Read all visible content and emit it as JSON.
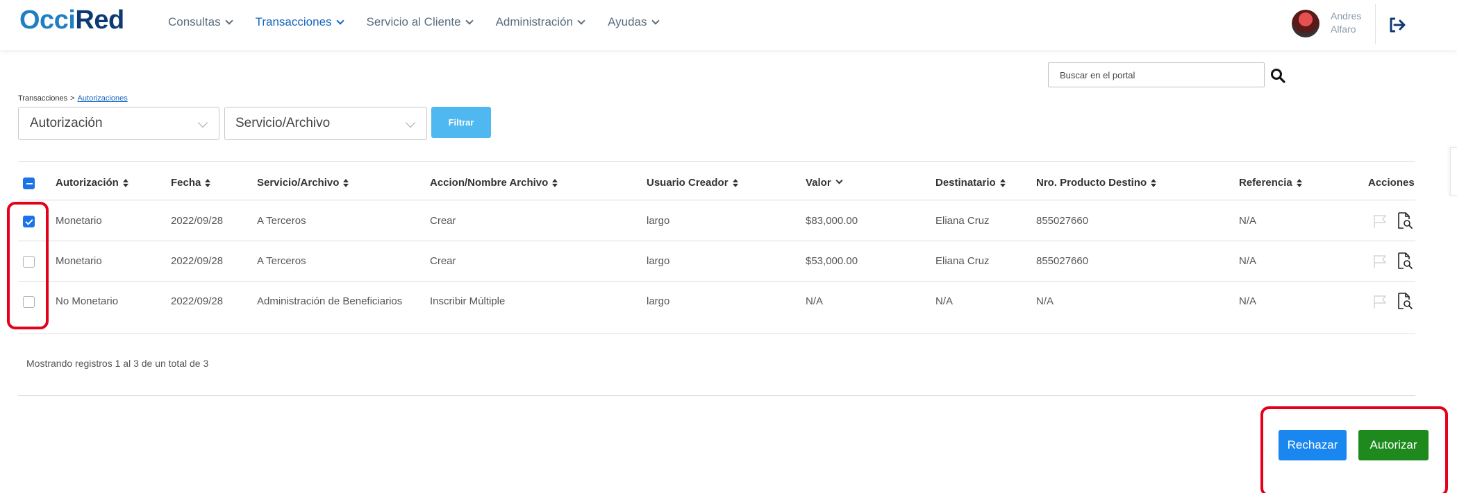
{
  "brand": {
    "part1": "Occi",
    "part2": "Red"
  },
  "nav": [
    {
      "label": "Consultas",
      "active": false
    },
    {
      "label": "Transacciones",
      "active": true
    },
    {
      "label": "Servicio al Cliente",
      "active": false
    },
    {
      "label": "Administración",
      "active": false
    },
    {
      "label": "Ayudas",
      "active": false
    }
  ],
  "user": {
    "first": "Andres",
    "last": "Alfaro"
  },
  "search": {
    "placeholder": "Buscar en el portal"
  },
  "breadcrumb": {
    "root": "Transacciones",
    "separator": ">",
    "current": "Autorizaciones"
  },
  "filters": {
    "type_select": "Autorización",
    "service_select": "Servicio/Archivo",
    "button": "Filtrar"
  },
  "table": {
    "columns": [
      "Autorización",
      "Fecha",
      "Servicio/Archivo",
      "Accion/Nombre Archivo",
      "Usuario Creador",
      "Valor",
      "Destinatario",
      "Nro. Producto Destino",
      "Referencia",
      "Acciones"
    ],
    "rows": [
      {
        "checked": true,
        "cells": [
          "Monetario",
          "2022/09/28",
          "A Terceros",
          "Crear",
          "largo",
          "$83,000.00",
          "Eliana Cruz",
          "855027660",
          "N/A"
        ]
      },
      {
        "checked": false,
        "cells": [
          "Monetario",
          "2022/09/28",
          "A Terceros",
          "Crear",
          "largo",
          "$53,000.00",
          "Eliana Cruz",
          "855027660",
          "N/A"
        ]
      },
      {
        "checked": false,
        "cells": [
          "No Monetario",
          "2022/09/28",
          "Administración de Beneficiarios",
          "Inscribir Múltiple",
          "largo",
          "N/A",
          "N/A",
          "N/A",
          "N/A"
        ]
      }
    ],
    "footer": "Mostrando registros 1 al 3 de un total de 3"
  },
  "actions": {
    "reject": "Rechazar",
    "authorize": "Autorizar"
  },
  "colors": {
    "brand_light": "#1f7fc4",
    "brand_dark": "#0e3a73",
    "filter": "#4fb8f0",
    "reject": "#1a86f0",
    "authorize": "#1e8a1e",
    "highlight": "#e5001a"
  },
  "icons": [
    "chevron-down-icon",
    "logout-icon",
    "search-icon",
    "sort-icon",
    "flag-icon",
    "document-search-icon",
    "checkbox-icon"
  ]
}
